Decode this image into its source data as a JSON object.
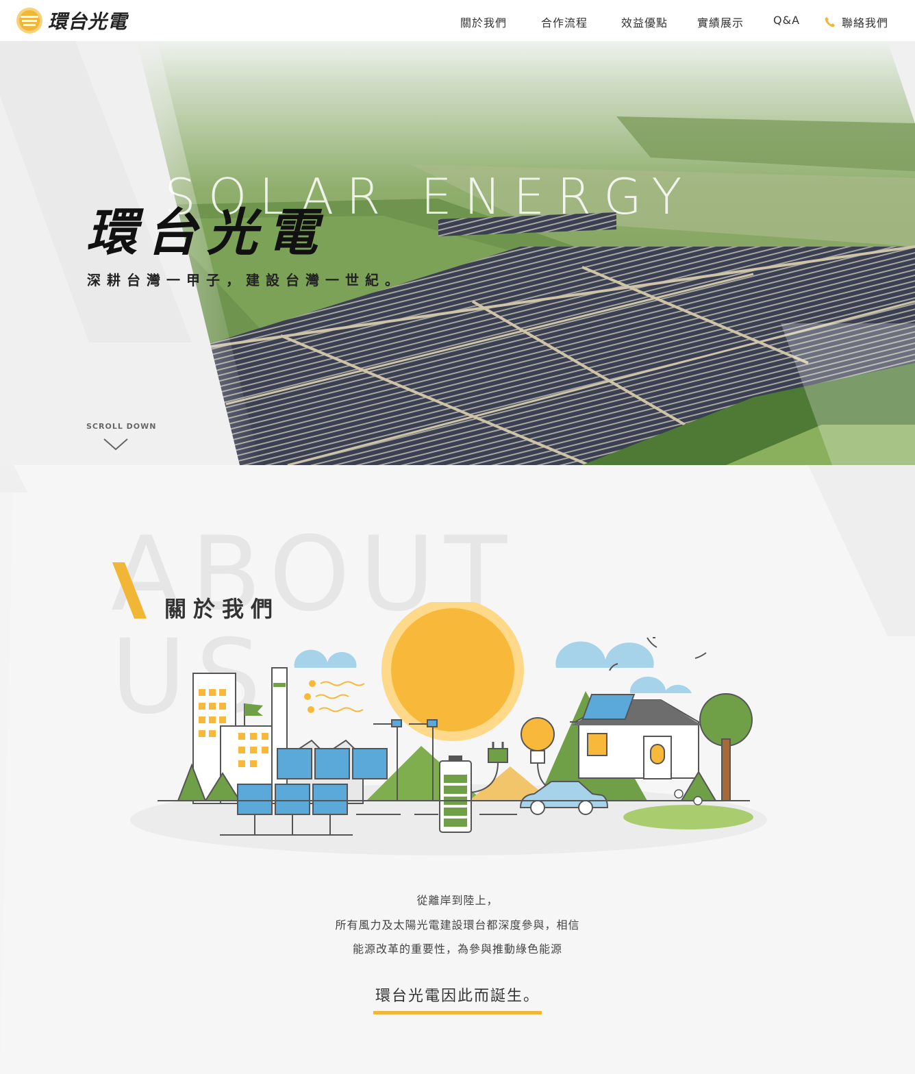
{
  "header": {
    "logo_text": "環台光電",
    "nav": [
      {
        "label": "關於我們"
      },
      {
        "label": "合作流程"
      },
      {
        "label": "效益優點"
      },
      {
        "label": "實績展示"
      },
      {
        "label": "Q&A"
      },
      {
        "label": "聯絡我們",
        "icon": "phone-icon"
      }
    ]
  },
  "hero": {
    "bg_word": "SOLAR ENERGY",
    "title": "環台光電",
    "slogan": "深耕台灣一甲子，建設台灣一世紀。",
    "scroll_label": "SCROLL DOWN"
  },
  "about": {
    "bg_word": "ABOUT\nUS",
    "heading": "關於我們",
    "paragraph": [
      "從離岸到陸上，",
      "所有風力及太陽光電建設環台都深度參與，相信",
      "能源改革的重要性，為參與推動綠色能源"
    ],
    "highlight": "環台光電因此而誕生。"
  },
  "colors": {
    "accent": "#f2b636",
    "text": "#333333",
    "background": "#f4f4f4"
  }
}
